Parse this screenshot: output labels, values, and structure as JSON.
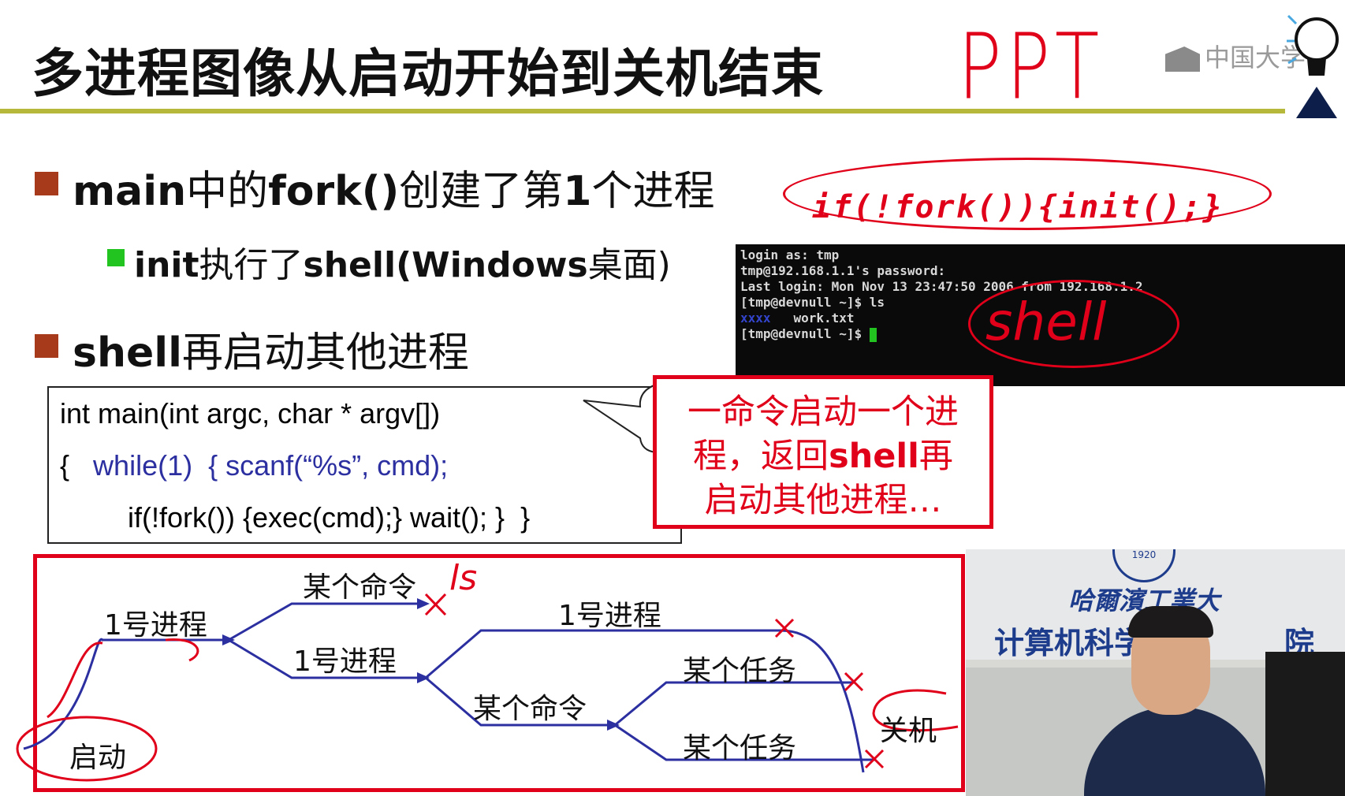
{
  "slide": {
    "title": "多进程图像从启动开始到关机结束",
    "handwritten_note": "PPT",
    "logo_text": "中国大学M"
  },
  "bullets": [
    {
      "prefix": "main",
      "mid1": "中的",
      "fork": "fork()",
      "rest": "创建了第",
      "num": "1",
      "tail": "个进程"
    },
    {
      "shell": "shell",
      "rest": "再启动其他进程"
    }
  ],
  "sub_bullet": {
    "init": "init",
    "rest1": "执行了",
    "shell": "shell",
    "rest2": "(Windows",
    "rest3": "桌面)"
  },
  "annotation_code": "if(!fork()){init();}",
  "terminal": {
    "lines": [
      "login as: tmp",
      "tmp@192.168.1.1's password:",
      "Last login: Mon Nov 13 23:47:50 2006 from 192.168.1.2",
      "[tmp@devnull ~]$ ls",
      "work.txt",
      "[tmp@devnull ~]$"
    ],
    "blue_prefix": "xxxx",
    "handwritten": "shell"
  },
  "code": {
    "line1": "int main(int argc, char * argv[])",
    "line2_brace": "{",
    "line2_while": "while(1)  { scanf(“%s”, cmd);",
    "line3": "if(!fork()) {exec(cmd);} wait(); }  }"
  },
  "callout": {
    "line1": "一命令启动一个进",
    "line2a": "程，返回",
    "line2b": "shell",
    "line2c": "再",
    "line3": "启动其他进程…"
  },
  "diagram": {
    "start": "启动",
    "proc1_a": "1号进程",
    "cmd_top": "某个命令",
    "proc1_b": "1号进程",
    "proc1_c": "1号进程",
    "cmd_mid": "某个命令",
    "task_a": "某个任务",
    "task_b": "某个任务",
    "shutdown": "关机",
    "handwritten_ls": "ls"
  },
  "video": {
    "sign_line1": "哈爾濱工業大",
    "sign_line2": "计算机科学与技",
    "sign_tail": "院",
    "emblem_year": "1920"
  },
  "colors": {
    "accent_red": "#e0001a",
    "code_blue": "#2b2fa0",
    "title_rule": "#b5b83a",
    "bullet_brown": "#a63a1a",
    "bullet_green": "#22c41f"
  }
}
